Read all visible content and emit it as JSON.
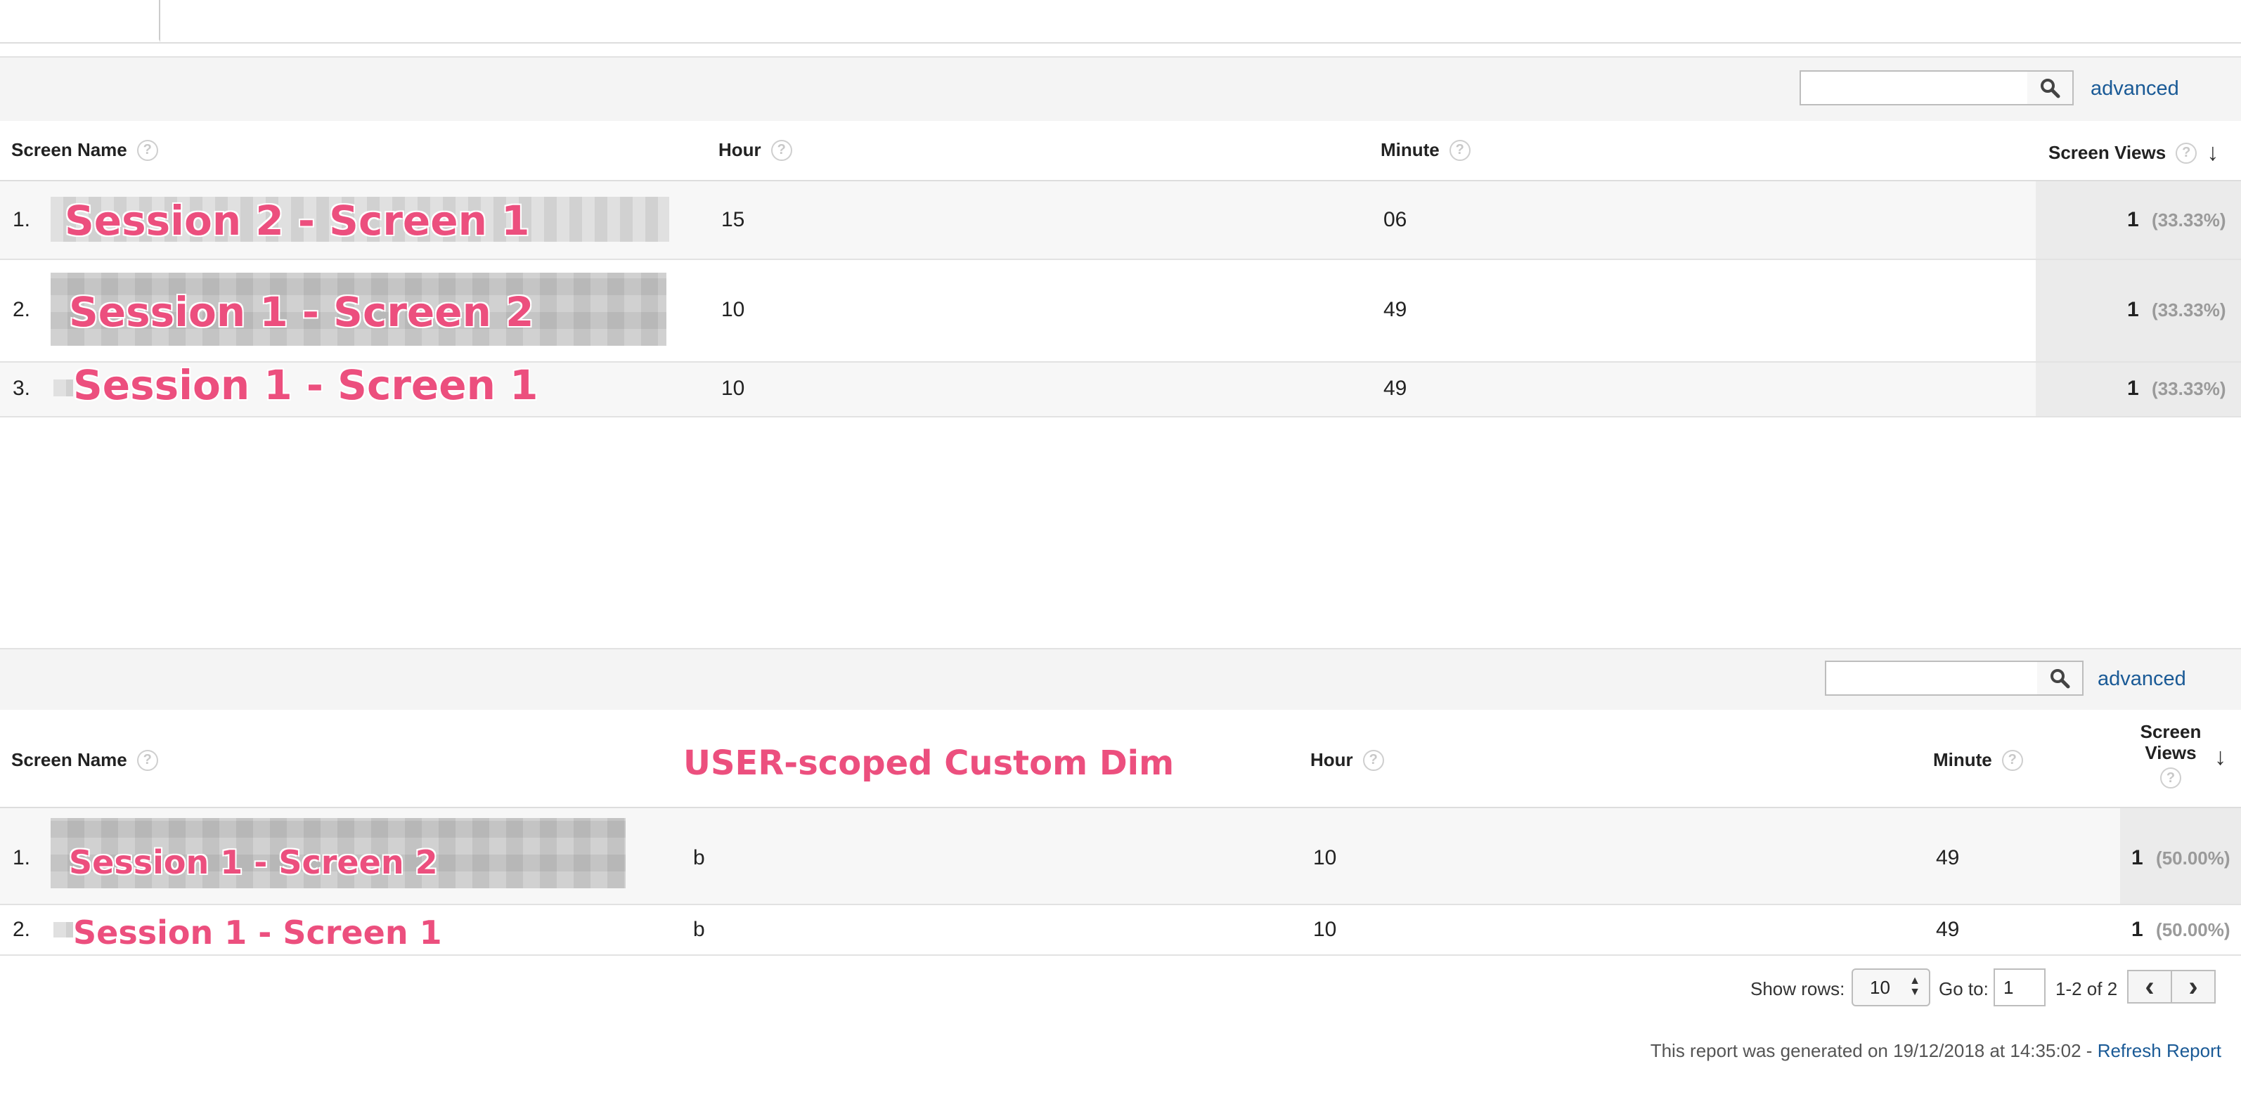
{
  "table1": {
    "search": {
      "value": "",
      "advanced_label": "advanced"
    },
    "headers": {
      "screen_name": "Screen Name",
      "hour": "Hour",
      "minute": "Minute",
      "screen_views": "Screen Views",
      "help": "?",
      "sort_icon": "arrow-down-icon",
      "sort_glyph": "↓"
    },
    "rows": [
      {
        "index": "1.",
        "annotation": "Session 2 - Screen 1",
        "hour": "15",
        "minute": "06",
        "views": "1",
        "pct": "(33.33%)"
      },
      {
        "index": "2.",
        "annotation": "Session 1 - Screen 2",
        "hour": "10",
        "minute": "49",
        "views": "1",
        "pct": "(33.33%)"
      },
      {
        "index": "3.",
        "annotation": "Session 1 - Screen 1",
        "hour": "10",
        "minute": "49",
        "views": "1",
        "pct": "(33.33%)"
      }
    ]
  },
  "table2": {
    "search": {
      "value": "",
      "advanced_label": "advanced"
    },
    "headers": {
      "screen_name": "Screen Name",
      "custom_dim_annotation": "USER-scoped Custom Dim",
      "hour": "Hour",
      "minute": "Minute",
      "screen_views": "Screen Views",
      "help": "?",
      "sort_icon": "arrow-down-icon",
      "sort_glyph": "↓"
    },
    "rows": [
      {
        "index": "1.",
        "annotation": "Session 1 - Screen 2",
        "custom_dim": "b",
        "hour": "10",
        "minute": "49",
        "views": "1",
        "pct": "(50.00%)"
      },
      {
        "index": "2.",
        "annotation": "Session 1 - Screen 1",
        "custom_dim": "b",
        "hour": "10",
        "minute": "49",
        "views": "1",
        "pct": "(50.00%)"
      }
    ],
    "pagination": {
      "show_rows_label": "Show rows:",
      "show_rows_value": "10",
      "go_to_label": "Go to:",
      "go_to_value": "1",
      "range": "1-2 of 2",
      "prev_glyph": "‹",
      "next_glyph": "›"
    }
  },
  "footer": {
    "generated_text": "This report was generated on 19/12/2018 at 14:35:02 - ",
    "refresh_label": "Refresh Report"
  },
  "colors": {
    "annotation": "#ec4f7e",
    "link": "#1a5a96"
  }
}
